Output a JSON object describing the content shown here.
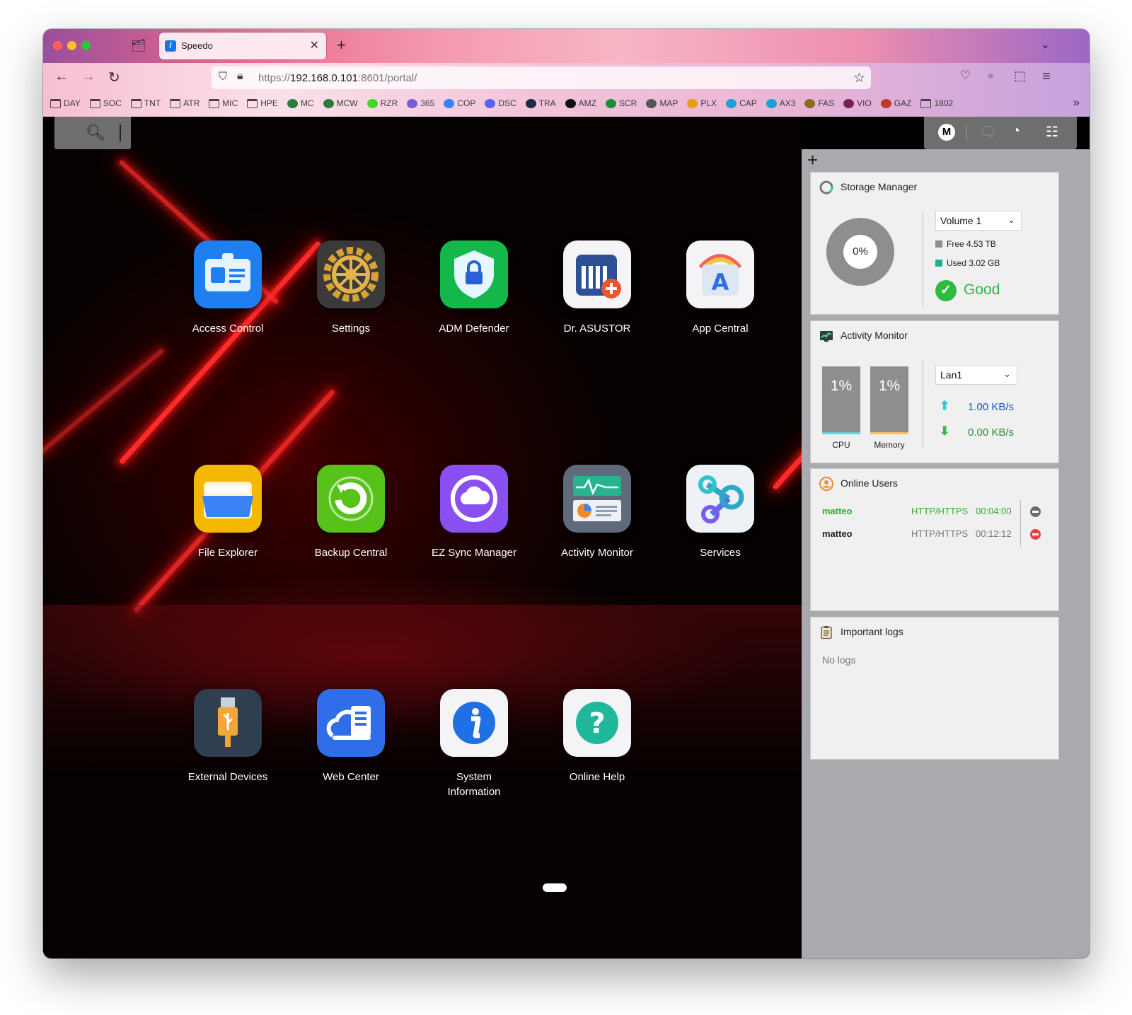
{
  "browser": {
    "tab_title": "Speedo",
    "tab_favicon": "asustor-favicon",
    "url_scheme": "https://",
    "url_host": "192.168.0.101",
    "url_rest": ":8601/portal/",
    "bookmarks": [
      {
        "label": "DAY",
        "icon": "folder"
      },
      {
        "label": "SOC",
        "icon": "folder"
      },
      {
        "label": "TNT",
        "icon": "folder"
      },
      {
        "label": "ATR",
        "icon": "folder"
      },
      {
        "label": "MIC",
        "icon": "folder"
      },
      {
        "label": "HPE",
        "icon": "folder"
      },
      {
        "label": "MC",
        "icon": "dot",
        "color": "#2b7a3e"
      },
      {
        "label": "MCW",
        "icon": "dot",
        "color": "#2b7a3e"
      },
      {
        "label": "RZR",
        "icon": "dot",
        "color": "#44d62c"
      },
      {
        "label": "365",
        "icon": "dot",
        "color": "#7b5bd6"
      },
      {
        "label": "COP",
        "icon": "dot",
        "color": "#3b82f6"
      },
      {
        "label": "DSC",
        "icon": "dot",
        "color": "#5865f2"
      },
      {
        "label": "TRA",
        "icon": "dot",
        "color": "#1f2a44"
      },
      {
        "label": "AMZ",
        "icon": "dot",
        "color": "#111111"
      },
      {
        "label": "SCR",
        "icon": "dot",
        "color": "#1c8f3a"
      },
      {
        "label": "MAP",
        "icon": "dot",
        "color": "#555555"
      },
      {
        "label": "PLX",
        "icon": "dot",
        "color": "#e5a00d"
      },
      {
        "label": "CAP",
        "icon": "dot",
        "color": "#1aa0d8"
      },
      {
        "label": "AX3",
        "icon": "dot",
        "color": "#1aa0d8"
      },
      {
        "label": "FAS",
        "icon": "dot",
        "color": "#8a6d1e"
      },
      {
        "label": "VIO",
        "icon": "dot",
        "color": "#7a1f5a"
      },
      {
        "label": "GAZ",
        "icon": "dot",
        "color": "#c0392b"
      },
      {
        "label": "1802",
        "icon": "folder"
      }
    ]
  },
  "topbar": {
    "avatar_letter": "M"
  },
  "apps": [
    {
      "label": "Access Control",
      "icon": "id-card-icon",
      "bg": "#1f7ef0"
    },
    {
      "label": "Settings",
      "icon": "gear-icon",
      "bg": "#3a3a3a"
    },
    {
      "label": "ADM Defender",
      "icon": "shield-lock-icon",
      "bg": "#14b84a"
    },
    {
      "label": "Dr. ASUSTOR",
      "icon": "nas-medic-icon",
      "bg": "#f4f4f6"
    },
    {
      "label": "App Central",
      "icon": "app-store-icon",
      "bg": "#f4f4f6"
    },
    {
      "label": "File Explorer",
      "icon": "folder-icon",
      "bg": "#f5b800"
    },
    {
      "label": "Backup Central",
      "icon": "backup-icon",
      "bg": "#57c21a"
    },
    {
      "label": "EZ Sync Manager",
      "icon": "cloud-sync-icon",
      "bg": "#8a4ff0"
    },
    {
      "label": "Activity Monitor",
      "icon": "monitor-chart-icon",
      "bg": "#5f6b7a"
    },
    {
      "label": "Services",
      "icon": "services-icon",
      "bg": "#eef1f6"
    },
    {
      "label": "External Devices",
      "icon": "usb-icon",
      "bg": "#2e3f52"
    },
    {
      "label": "Web Center",
      "icon": "web-server-icon",
      "bg": "#2f6ee8"
    },
    {
      "label": "System Information",
      "icon": "info-icon",
      "bg": "#f4f4f6"
    },
    {
      "label": "Online Help",
      "icon": "help-icon",
      "bg": "#f4f4f6"
    }
  ],
  "widgets": {
    "storage": {
      "title": "Storage Manager",
      "percent": "0%",
      "volume": "Volume 1",
      "free": "Free 4.53 TB",
      "used": "Used 3.02 GB",
      "status": "Good",
      "free_color": "#8e8e8e",
      "used_color": "#1fae8e",
      "status_color": "#31b34a"
    },
    "activity": {
      "title": "Activity Monitor",
      "cpu_value": "1%",
      "cpu_label": "CPU",
      "cpu_fill": 0.01,
      "memory_value": "1%",
      "memory_label": "Memory",
      "memory_fill": 0.01,
      "interface": "Lan1",
      "upload": "1.00 KB/s",
      "download": "0.00 KB/s"
    },
    "users": {
      "title": "Online Users",
      "rows": [
        {
          "name": "matteo",
          "protocol": "HTTP/HTTPS",
          "time": "00:04:00",
          "active": true
        },
        {
          "name": "matteo",
          "protocol": "HTTP/HTTPS",
          "time": "00:12:12",
          "active": false
        }
      ]
    },
    "logs": {
      "title": "Important logs",
      "empty": "No logs"
    }
  }
}
